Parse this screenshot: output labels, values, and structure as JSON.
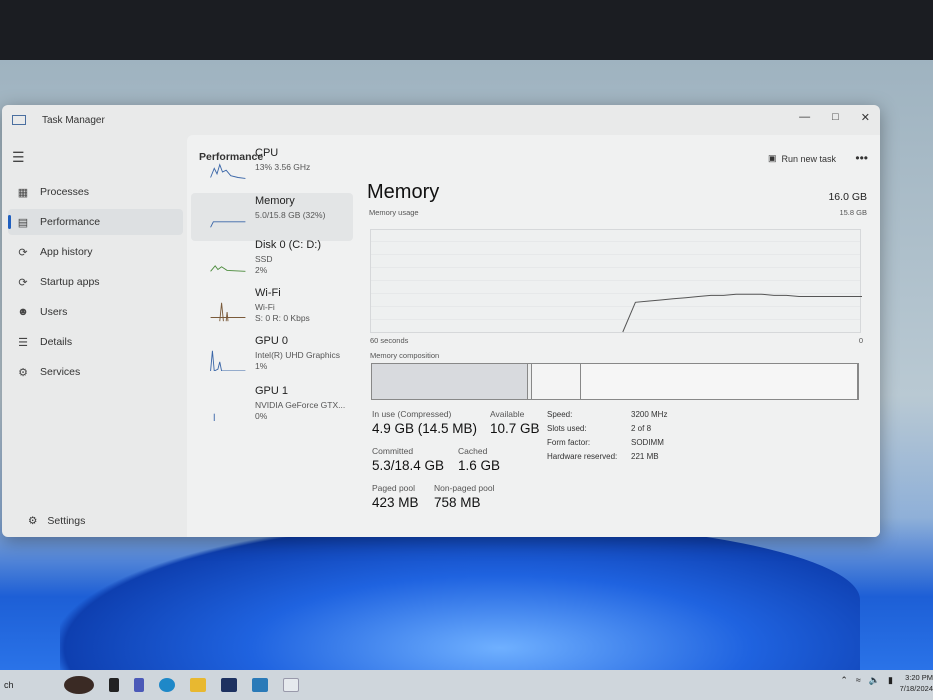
{
  "window": {
    "title": "Task Manager",
    "minimize_icon": "minimize-icon",
    "maximize_icon": "maximize-icon",
    "close_icon": "close-icon"
  },
  "sidebar": {
    "items": [
      {
        "label": "Processes",
        "icon": "processes-icon"
      },
      {
        "label": "Performance",
        "icon": "performance-icon"
      },
      {
        "label": "App history",
        "icon": "history-icon"
      },
      {
        "label": "Startup apps",
        "icon": "startup-icon"
      },
      {
        "label": "Users",
        "icon": "users-icon"
      },
      {
        "label": "Details",
        "icon": "details-icon"
      },
      {
        "label": "Services",
        "icon": "services-icon"
      }
    ],
    "settings": "Settings"
  },
  "header": {
    "title": "Performance",
    "run_new_task": "Run new task",
    "more": "•••"
  },
  "devices": [
    {
      "name": "CPU",
      "line1": "13% 3.56 GHz",
      "line2": ""
    },
    {
      "name": "Memory",
      "line1": "5.0/15.8 GB (32%)",
      "line2": ""
    },
    {
      "name": "Disk 0 (C: D:)",
      "line1": "SSD",
      "line2": "2%"
    },
    {
      "name": "Wi-Fi",
      "line1": "Wi-Fi",
      "line2": "S: 0 R: 0 Kbps"
    },
    {
      "name": "GPU 0",
      "line1": "Intel(R) UHD Graphics",
      "line2": "1%"
    },
    {
      "name": "GPU 1",
      "line1": "NVIDIA GeForce GTX...",
      "line2": "0%"
    }
  ],
  "memory": {
    "title": "Memory",
    "total": "16.0 GB",
    "usage_label": "Memory usage",
    "usage_max": "15.8 GB",
    "time_left": "60 seconds",
    "time_right": "0",
    "composition_label": "Memory composition",
    "composition": {
      "in_use_pct": 32,
      "modified_pct": 1,
      "standby_pct": 10
    },
    "usage_history_pct": [
      null,
      null,
      null,
      null,
      null,
      null,
      null,
      null,
      null,
      null,
      null,
      null,
      null,
      null,
      null,
      null,
      null,
      null,
      null,
      null,
      0,
      26,
      27,
      28,
      29,
      30,
      31,
      32,
      32,
      33,
      33,
      33,
      32,
      32,
      31,
      31,
      31,
      31,
      31,
      31
    ],
    "stats": [
      {
        "label": "In use (Compressed)",
        "value": "4.9 GB (14.5 MB)"
      },
      {
        "label": "Available",
        "value": "10.7 GB"
      },
      {
        "label": "Committed",
        "value": "5.3/18.4 GB"
      },
      {
        "label": "Cached",
        "value": "1.6 GB"
      },
      {
        "label": "Paged pool",
        "value": "423 MB"
      },
      {
        "label": "Non-paged pool",
        "value": "758 MB"
      }
    ],
    "details": [
      {
        "key": "Speed:",
        "value": "3200 MHz"
      },
      {
        "key": "Slots used:",
        "value": "2 of 8"
      },
      {
        "key": "Form factor:",
        "value": "SODIMM"
      },
      {
        "key": "Hardware reserved:",
        "value": "221 MB"
      }
    ]
  },
  "taskbar": {
    "search": "ch",
    "clock_time": "3:20 PM",
    "clock_date": "7/18/2024"
  }
}
